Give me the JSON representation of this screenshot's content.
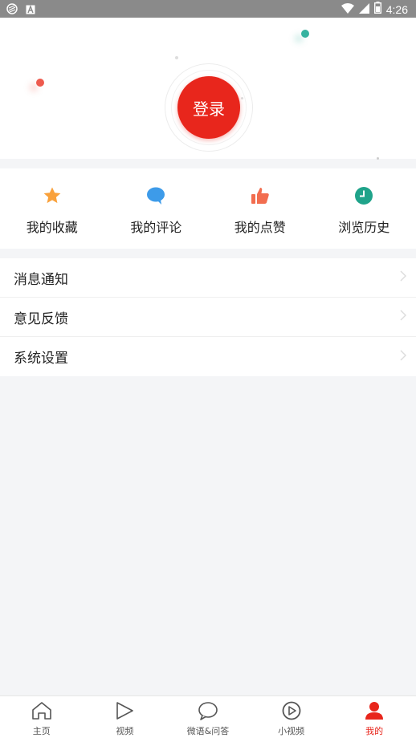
{
  "status_bar": {
    "time": "4:26"
  },
  "header": {
    "login_label": "登录"
  },
  "quick_actions": [
    {
      "label": "我的收藏",
      "icon": "star-icon",
      "color": "#f9a13b"
    },
    {
      "label": "我的评论",
      "icon": "comment-icon",
      "color": "#3d9be9"
    },
    {
      "label": "我的点赞",
      "icon": "thumbs-up-icon",
      "color": "#f26d4f"
    },
    {
      "label": "浏览历史",
      "icon": "clock-icon",
      "color": "#1fa38a"
    }
  ],
  "menu": [
    {
      "label": "消息通知"
    },
    {
      "label": "意见反馈"
    },
    {
      "label": "系统设置"
    }
  ],
  "bottom_nav": [
    {
      "label": "主页",
      "icon": "home-icon"
    },
    {
      "label": "视频",
      "icon": "play-icon"
    },
    {
      "label": "微语&问答",
      "icon": "chat-bubble-icon"
    },
    {
      "label": "小视频",
      "icon": "circle-play-icon"
    },
    {
      "label": "我的",
      "icon": "user-icon",
      "active": true
    }
  ],
  "colors": {
    "accent": "#e8261c",
    "background": "#f4f5f7"
  }
}
